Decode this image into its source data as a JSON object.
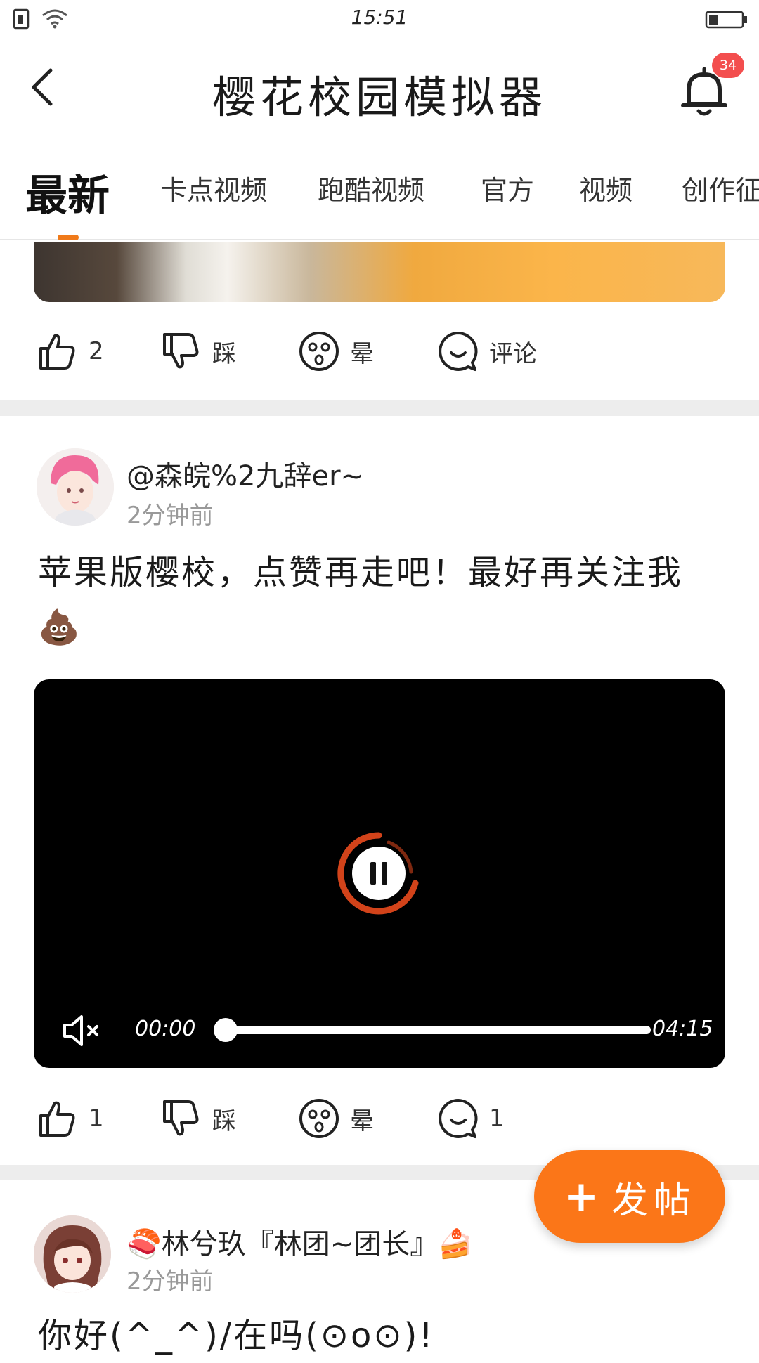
{
  "status": {
    "time": "15:51"
  },
  "header": {
    "title": "樱花校园模拟器",
    "notification_count": "34"
  },
  "tabs": [
    {
      "label": "最新",
      "active": true
    },
    {
      "label": "卡点视频"
    },
    {
      "label": "跑酷视频"
    },
    {
      "label": "官方"
    },
    {
      "label": "视频"
    },
    {
      "label": "创作征"
    }
  ],
  "prev_post_actions": {
    "like_count": "2",
    "dislike_label": "踩",
    "dizzy_label": "晕",
    "comment_label": "评论"
  },
  "post1": {
    "username": "@森皖%2九辞er~",
    "time": "2分钟前",
    "text": "苹果版樱校，点赞再走吧！最好再关注我💩",
    "video": {
      "current_time": "00:00",
      "total_time": "04:15",
      "progress": 0
    },
    "actions": {
      "like_count": "1",
      "dislike_label": "踩",
      "dizzy_label": "晕",
      "comment_count": "1"
    }
  },
  "post2": {
    "username": "🍣林兮玖『林团~团长』🍰",
    "time": "2分钟前",
    "text": "你好(^_^)/在吗(⊙o⊙)!"
  },
  "fab": {
    "plus": "+",
    "label": "发帖"
  },
  "colors": {
    "accent": "#fb7618",
    "badge": "#f34e4e",
    "divider": "#ededed"
  }
}
